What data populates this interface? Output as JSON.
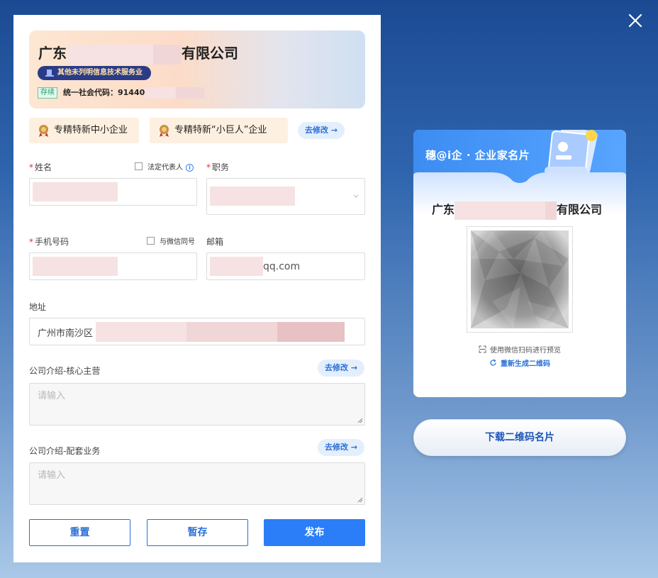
{
  "window": {
    "close_icon": "close-icon"
  },
  "company_card": {
    "name_prefix": "广东",
    "name_suffix": "有限公司",
    "industry": "其他未列明信息技术服务业",
    "status": "存续",
    "credit_code_label": "统一社会代码：91440"
  },
  "qualifications": [
    {
      "label": "专精特新中小企业",
      "icon": "award-medal-icon"
    },
    {
      "label": "专精特新“小巨人”企业",
      "icon": "award-medal-icon"
    }
  ],
  "edit_link_label": "去修改",
  "form": {
    "name_label": "姓名",
    "legal_rep_label": "法定代表人",
    "position_label": "职务",
    "phone_label": "手机号码",
    "same_wechat_label": "与微信同号",
    "email_label": "邮箱",
    "email_value": "qq.com",
    "address_label": "地址",
    "address_value": "广州市南沙区",
    "core_business_label": "公司介绍-核心主营",
    "core_business_placeholder": "请输入",
    "supporting_business_label": "公司介绍-配套业务",
    "supporting_business_placeholder": "请输入"
  },
  "buttons": {
    "reset": "重置",
    "save": "暂存",
    "publish": "发布"
  },
  "business_card": {
    "title": "穗@i企 · 企业家名片",
    "company_prefix": "广东",
    "company_suffix": "有限公司",
    "scan_tip": "使用微信扫码进行预览",
    "regenerate": "重新生成二维码"
  },
  "download_button": "下载二维码名片",
  "colors": {
    "primary": "#2b7ef8",
    "link": "#2a6fd6",
    "required": "#e03131"
  }
}
